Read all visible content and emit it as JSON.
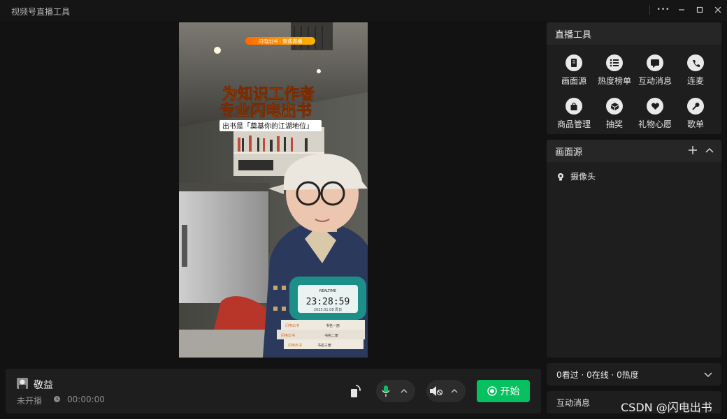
{
  "app": {
    "title": "视频号直播工具"
  },
  "window_controls": {
    "more": "•••"
  },
  "preview": {
    "ribbon": "闪电出书 · 聚焦直播",
    "headline_1": "为知识工作者",
    "headline_2": "专业闪电出书",
    "tagline": "出书是「奠基你的江湖地位」",
    "clock": {
      "top": "REALTIME",
      "time": "23:28:59",
      "bottom": "2023.01.08 周日"
    },
    "book_labels": [
      "闪电出书",
      "闪电出书",
      "闪电出书"
    ],
    "book_titles": [
      "书名一册",
      "书名二册",
      "书名三册"
    ]
  },
  "user": {
    "name": "敬益",
    "status": "未开播",
    "timer": "00:00:00"
  },
  "controls": {
    "start_label": "开始"
  },
  "tools_panel": {
    "title": "直播工具",
    "items": [
      {
        "label": "画面源",
        "icon": "screen-source-icon"
      },
      {
        "label": "热度榜单",
        "icon": "list-icon"
      },
      {
        "label": "互动消息",
        "icon": "chat-icon"
      },
      {
        "label": "连麦",
        "icon": "phone-icon"
      },
      {
        "label": "商品管理",
        "icon": "shopping-bag-icon"
      },
      {
        "label": "抽奖",
        "icon": "gift-box-icon"
      },
      {
        "label": "礼物心愿",
        "icon": "heart-icon"
      },
      {
        "label": "歌单",
        "icon": "microphone-icon"
      }
    ]
  },
  "source_panel": {
    "title": "画面源",
    "items": [
      {
        "label": "摄像头"
      }
    ]
  },
  "stats": {
    "text": "0看过 · 0在线 · 0热度"
  },
  "messages_panel": {
    "title": "互动消息"
  },
  "watermark": {
    "text": "CSDN @闪电出书"
  },
  "colors": {
    "accent": "#07c160",
    "panel": "#1e1e1e",
    "background": "#121212"
  }
}
